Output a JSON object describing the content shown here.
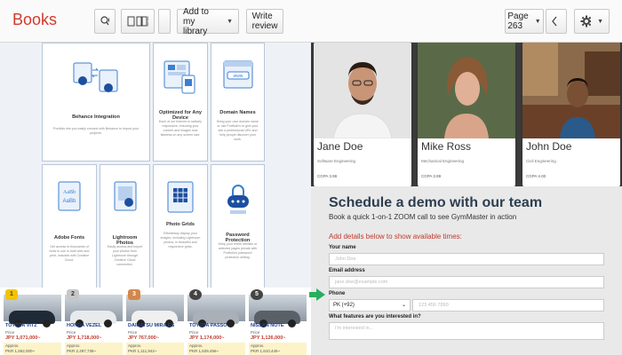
{
  "toolbar": {
    "brand": "Books",
    "add_library": "Add to my library",
    "write_review": "Write review",
    "page": "Page 263"
  },
  "features": [
    {
      "title": "Behance Integration",
      "desc": "Portfolio lets you easily connect with Behance to import your projects."
    },
    {
      "title": "Optimized for Any Device",
      "desc": "Each of our themes is natively responsive, ensuring your content and images look flawless on any screen size."
    },
    {
      "title": "Domain Names",
      "desc": "Bring your own domain name or use Portfolio's to give your site a professional URL and help people discover your work."
    },
    {
      "title": "Adobe Fonts",
      "desc": "Get access to thousands of fonts to use in both web and print, included with Creative Cloud."
    },
    {
      "title": "Lightroom Photos",
      "desc": "Easily access and import your photos from Lightroom through Creative Cloud connection."
    },
    {
      "title": "Photo Grids",
      "desc": "Effortlessly display your images, including Lightroom photos, in beautiful and responsive grids."
    },
    {
      "title": "Password Protection",
      "desc": "Keep your entire website or selected pages private with Portfolio's password protection setting."
    }
  ],
  "cars": [
    {
      "rank": "1",
      "name": "TOYOTA VITZ",
      "price_label": "Price",
      "price": "JPY 1,071,000~",
      "approx_label": "Approx.",
      "approx": "PKR 1,552,000~",
      "color": "#1f2a36"
    },
    {
      "rank": "2",
      "name": "HONDA VEZEL",
      "price_label": "Price",
      "price": "JPY 1,718,000~",
      "approx_label": "Approx.",
      "approx": "PKR 2,497,738~",
      "color": "#e8eaec"
    },
    {
      "rank": "3",
      "name": "DAIHATSU MIRA ES",
      "price_label": "Price",
      "price": "JPY 767,000~",
      "approx_label": "Approx.",
      "approx": "PKR 1,111,942~",
      "color": "#f0f0f0"
    },
    {
      "rank": "4",
      "name": "TOYOTA PASSO",
      "price_label": "Price",
      "price": "JPY 1,174,000~",
      "approx_label": "Approx.",
      "approx": "PKR 1,629,456~",
      "color": "#a9b0b7"
    },
    {
      "rank": "5",
      "name": "NISSAN NOTE",
      "price_label": "Price",
      "price": "JPY 1,126,000~",
      "approx_label": "Approx.",
      "approx": "PKR 1,610,445~",
      "color": "#5a6068"
    }
  ],
  "people": [
    {
      "name": "Jane Doe",
      "role": "Software Engineering",
      "gpa": "CGPA 3.98"
    },
    {
      "name": "Mike Ross",
      "role": "Mechanical Engineering",
      "gpa": "CGPA 3.89"
    },
    {
      "name": "John Doe",
      "role": "Civil Engineering",
      "gpa": "CGPA 4.00"
    }
  ],
  "form": {
    "heading": "Schedule a demo with our team",
    "subheading": "Book a quick 1-on-1 ZOOM call to see GymMaster in action",
    "details": "Add details below to show available times:",
    "name_label": "Your name",
    "name_placeholder": "John Doe",
    "email_label": "Email address",
    "email_placeholder": "jane.doe@example.com",
    "phone_label": "Phone",
    "country_code": "PK (+92)",
    "phone_placeholder": "123 456 7890",
    "features_label": "What features are you interested in?",
    "features_placeholder": "I'm interested in..."
  },
  "colors": {
    "brand": "#d33a2c",
    "heading": "#2d3e50",
    "accent_red": "#c0392b",
    "arrow": "#27ae60"
  }
}
